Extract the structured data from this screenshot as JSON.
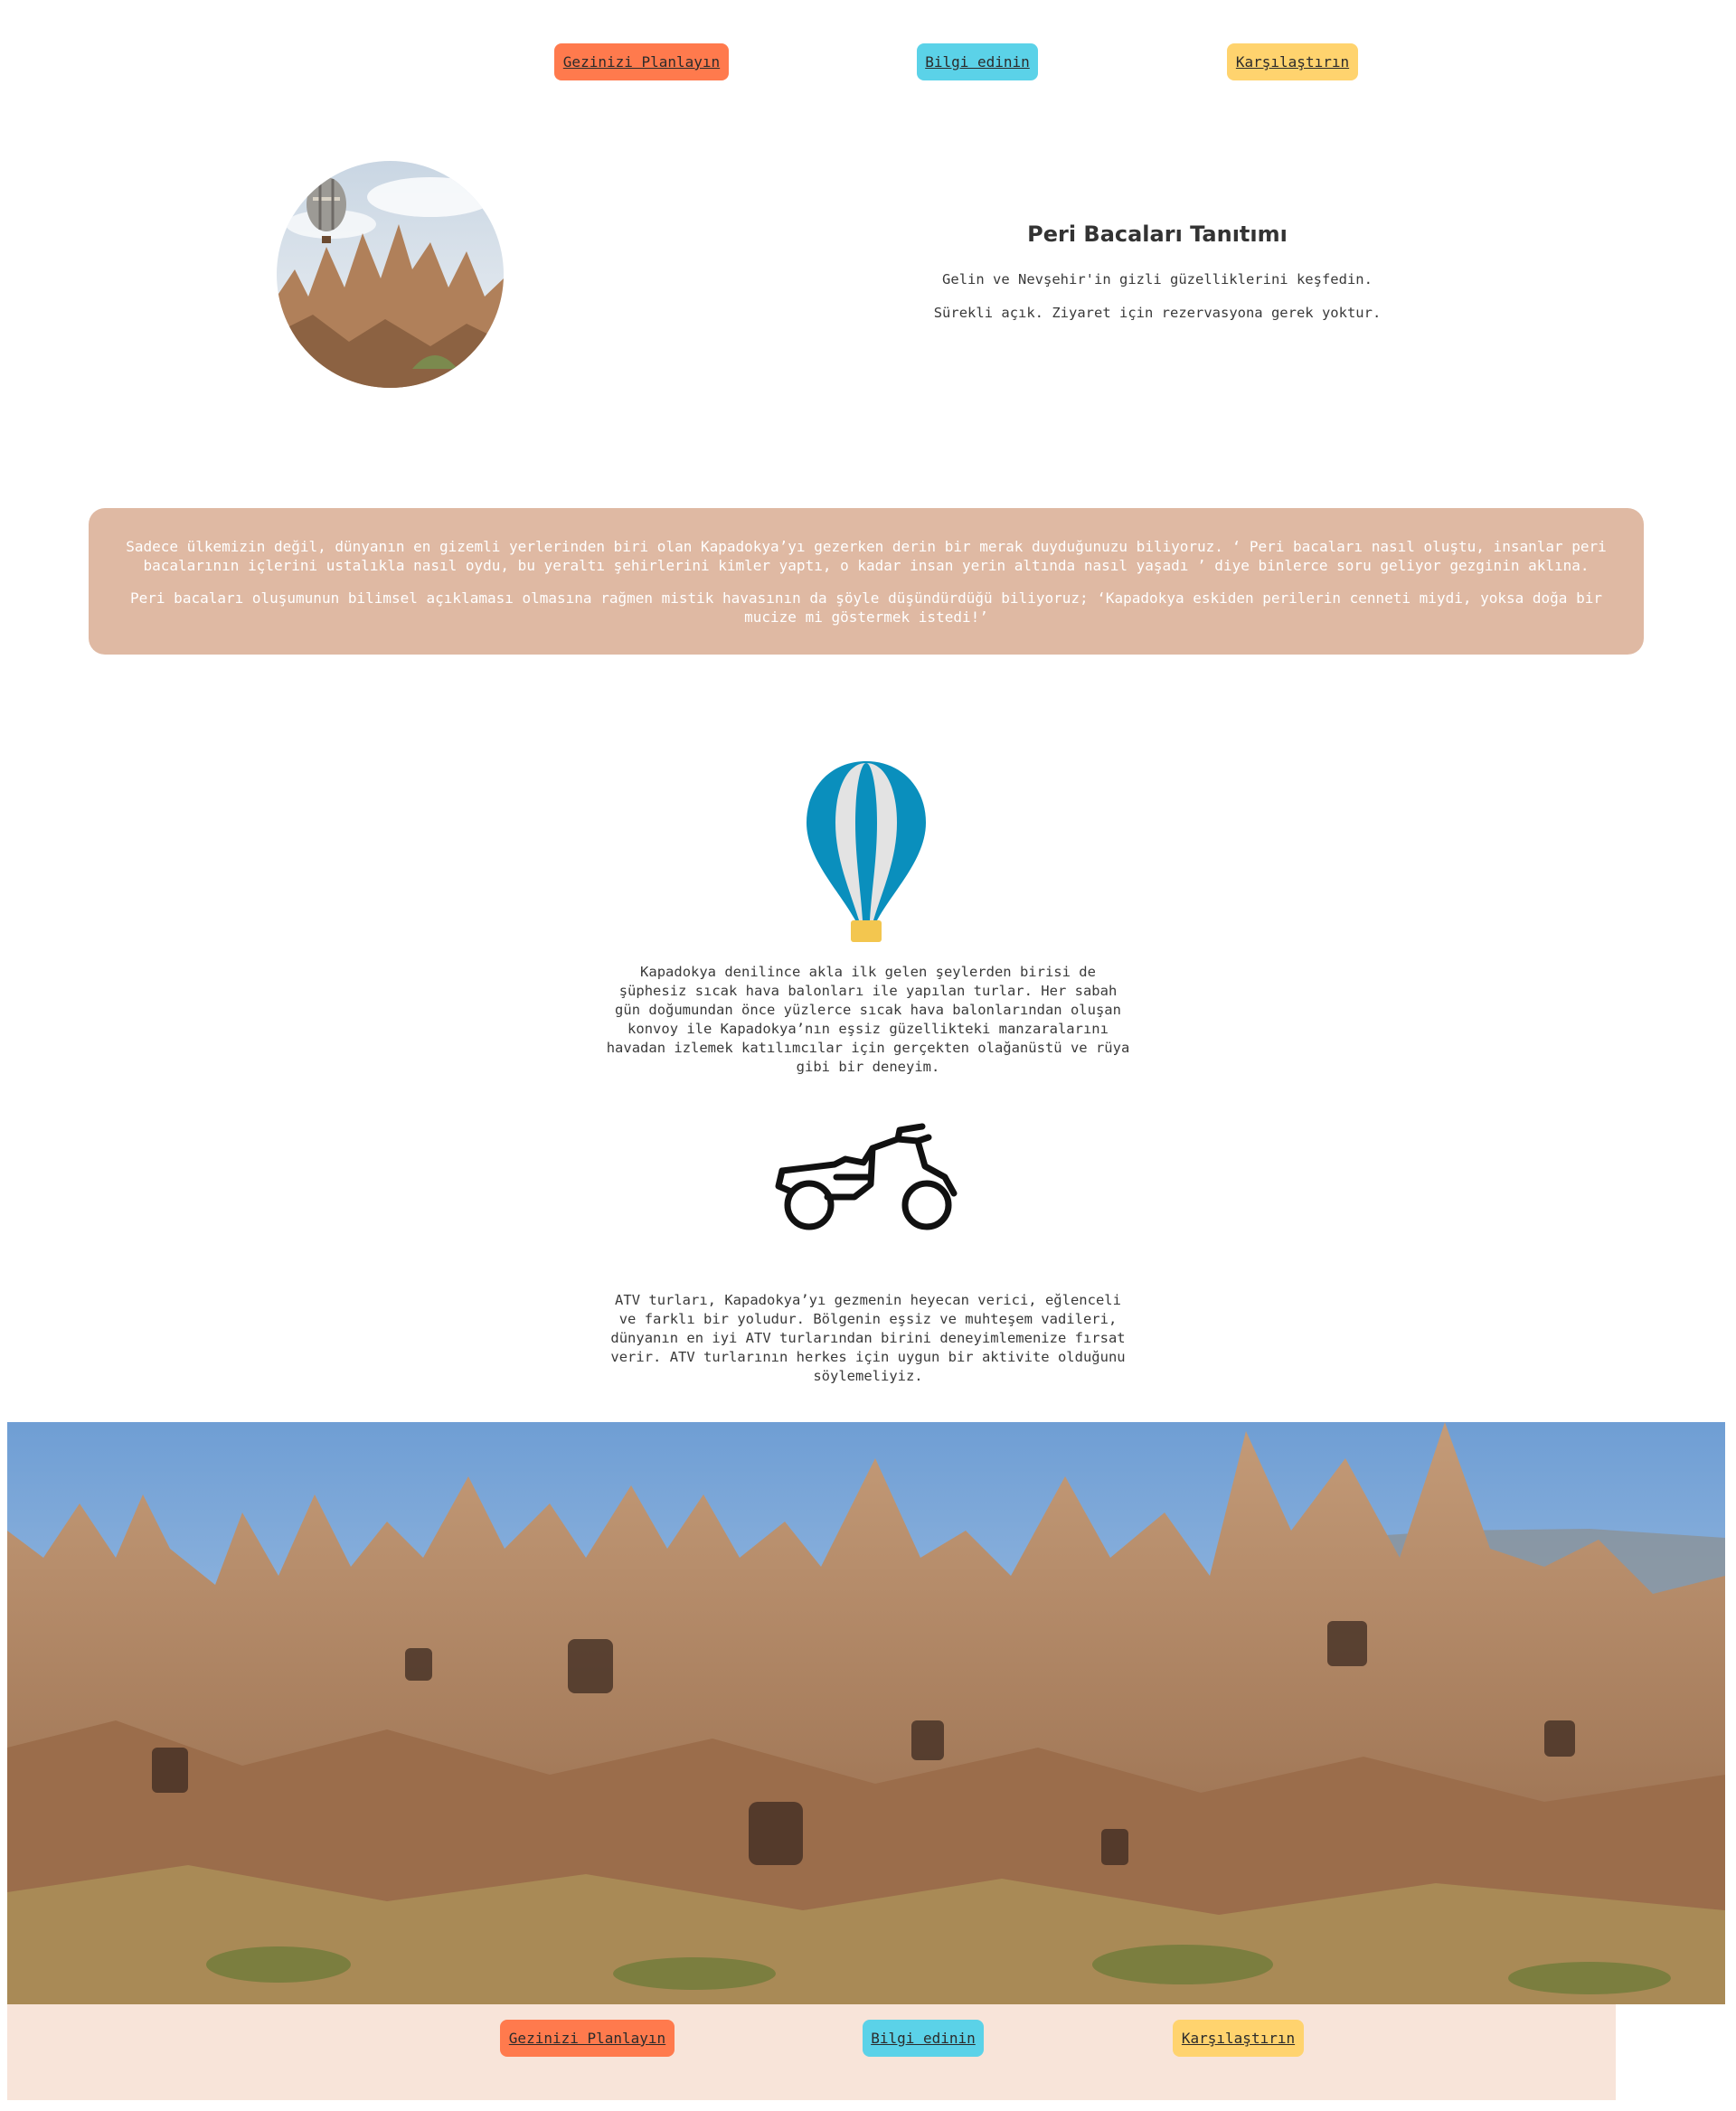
{
  "nav": {
    "plan": "Gezinizi Planlayın",
    "learn": "Bilgi edinin",
    "compare": "Karşılaştırın"
  },
  "intro": {
    "title": "Peri Bacaları Tanıtımı",
    "line1": "Gelin ve Nevşehir'in gizli güzelliklerini keşfedin.",
    "line2": "Sürekli açık. Ziyaret için rezervasyona gerek yoktur."
  },
  "info": {
    "p1": "Sadece ülkemizin değil, dünyanın en gizemli yerlerinden biri olan Kapadokya’yı gezerken derin bir merak duyduğunuzu biliyoruz. ‘ Peri bacaları nasıl oluştu, insanlar peri bacalarının içlerini ustalıkla nasıl oydu, bu yeraltı şehirlerini kimler yaptı, o kadar insan yerin altında nasıl yaşadı ’ diye binlerce soru geliyor gezginin aklına.",
    "p2": "Peri bacaları oluşumunun bilimsel açıklaması olmasına rağmen mistik havasının da şöyle düşündürdüğü biliyoruz; ‘Kapadokya eskiden perilerin cenneti miydi, yoksa doğa bir mucize mi göstermek istedi!’"
  },
  "features": {
    "balloon_icon": "hot-air-balloon-icon",
    "balloon_text": "Kapadokya denilince akla ilk gelen şeylerden birisi de şüphesiz sıcak hava balonları ile yapılan turlar. Her sabah gün doğumundan önce yüzlerce sıcak hava balonlarından oluşan konvoy ile Kapadokya’nın eşsiz güzellikteki manzaralarını havadan izlemek katılımcılar için gerçekten olağanüstü ve rüya gibi bir deneyim.",
    "atv_icon": "atv-icon",
    "atv_text": "ATV turları, Kapadokya’yı gezmenin heyecan verici, eğlenceli ve farklı bir yoludur. Bölgenin eşsiz ve muhteşem vadileri, dünyanın en iyi ATV turlarından birini deneyimlemenize fırsat verir. ATV turlarının herkes için uygun bir aktivite olduğunu söylemeliyiz."
  },
  "footer_nav": {
    "plan": "Gezinizi Planlayın",
    "learn": "Bilgi edinin",
    "compare": "Karşılaştırın"
  },
  "colors": {
    "btn_plan": "#ff7a4d",
    "btn_learn": "#5bd2e8",
    "btn_compare": "#ffd36e",
    "info_box": "#dfb9a3",
    "footer_bg": "#f8e4d9",
    "balloon_blue": "#0a8fbd"
  }
}
